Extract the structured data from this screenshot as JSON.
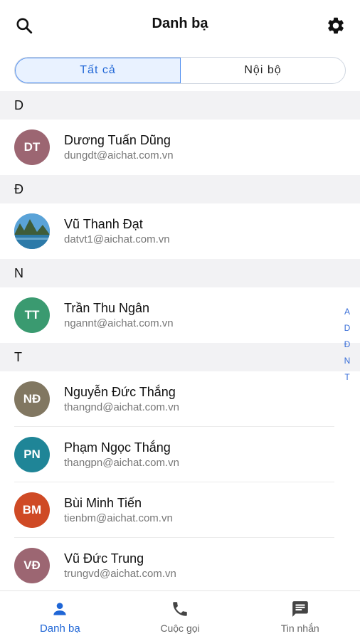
{
  "header": {
    "title": "Danh bạ"
  },
  "segments": {
    "all": "Tất cả",
    "internal": "Nội bộ"
  },
  "sections": [
    {
      "letter": "D",
      "contacts": [
        {
          "initials": "DT",
          "name": "Dương Tuấn Dũng",
          "email": "dungdt@aichat.com.vn",
          "color": "#9c6672"
        }
      ]
    },
    {
      "letter": "Đ",
      "contacts": [
        {
          "initials": "",
          "name": "Vũ Thanh Đạt",
          "email": "datvt1@aichat.com.vn",
          "color": "#3a84b8",
          "photo": "landscape"
        }
      ]
    },
    {
      "letter": "N",
      "contacts": [
        {
          "initials": "TT",
          "name": "Trần Thu Ngân",
          "email": "ngannt@aichat.com.vn",
          "color": "#3a9a70"
        }
      ]
    },
    {
      "letter": "T",
      "contacts": [
        {
          "initials": "NĐ",
          "name": "Nguyễn Đức Thắng",
          "email": "thangnd@aichat.com.vn",
          "color": "#817761"
        },
        {
          "initials": "PN",
          "name": "Phạm Ngọc Thắng",
          "email": "thangpn@aichat.com.vn",
          "color": "#1f8597"
        },
        {
          "initials": "BM",
          "name": "Bùi Minh Tiến",
          "email": "tienbm@aichat.com.vn",
          "color": "#cf4a25"
        },
        {
          "initials": "VĐ",
          "name": "Vũ Đức Trung",
          "email": "trungvd@aichat.com.vn",
          "color": "#9c6672"
        }
      ]
    }
  ],
  "index_letters": [
    "A",
    "D",
    "Đ",
    "N",
    "T"
  ],
  "bottom_nav": [
    {
      "label": "Danh bạ",
      "icon": "person-icon",
      "active": true
    },
    {
      "label": "Cuộc gọi",
      "icon": "phone-icon",
      "active": false
    },
    {
      "label": "Tin nhắn",
      "icon": "message-icon",
      "active": false
    }
  ],
  "colors": {
    "accent": "#1f66d6",
    "section_bg": "#f2f2f4"
  }
}
